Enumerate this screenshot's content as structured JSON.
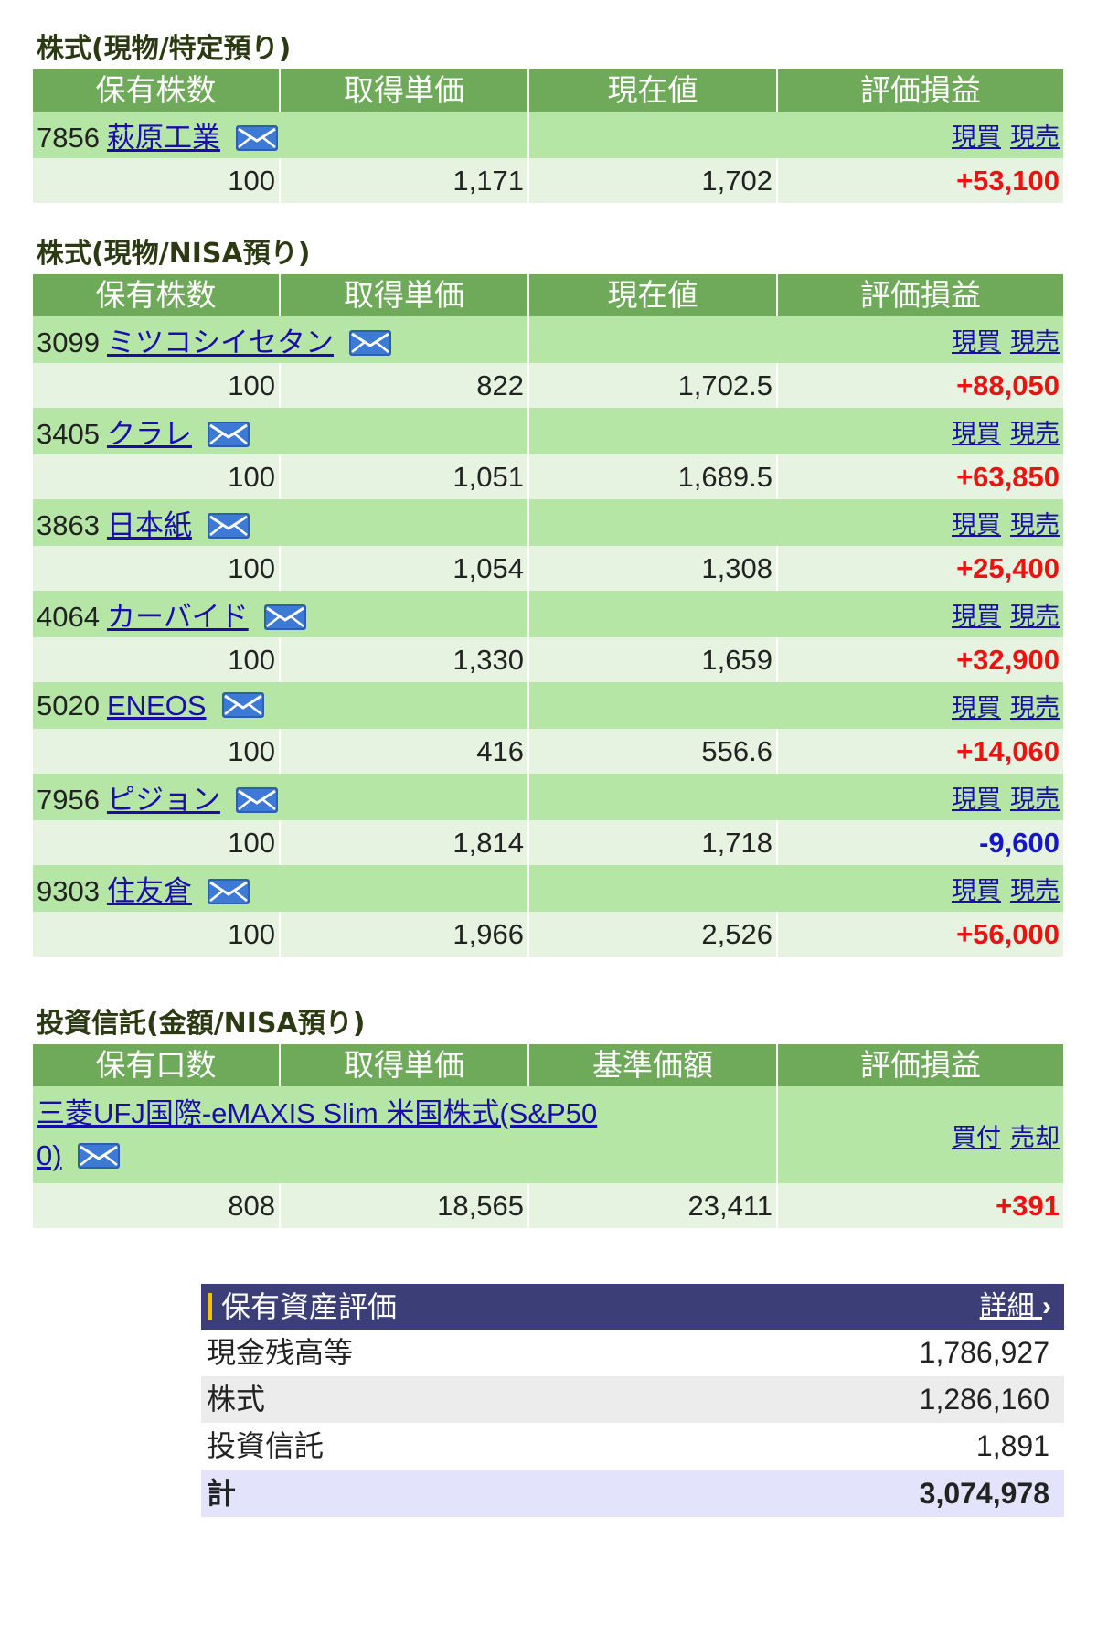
{
  "headers_stock": [
    "保有株数",
    "取得単価",
    "現在値",
    "評価損益"
  ],
  "headers_fund": [
    "保有口数",
    "取得単価",
    "基準価額",
    "評価損益"
  ],
  "actions_stock": {
    "buy": "現買",
    "sell": "現売"
  },
  "actions_fund": {
    "buy": "買付",
    "sell": "売却"
  },
  "section1": {
    "title": "株式(現物/特定預り)",
    "rows": [
      {
        "code": "7856",
        "name": "萩原工業",
        "qty": "100",
        "cost": "1,171",
        "price": "1,702",
        "pl": "+53,100"
      }
    ]
  },
  "section2": {
    "title": "株式(現物/NISA預り)",
    "rows": [
      {
        "code": "3099",
        "name": "ミツコシイセタン",
        "qty": "100",
        "cost": "822",
        "price": "1,702.5",
        "pl": "+88,050"
      },
      {
        "code": "3405",
        "name": "クラレ",
        "qty": "100",
        "cost": "1,051",
        "price": "1,689.5",
        "pl": "+63,850"
      },
      {
        "code": "3863",
        "name": "日本紙",
        "qty": "100",
        "cost": "1,054",
        "price": "1,308",
        "pl": "+25,400"
      },
      {
        "code": "4064",
        "name": "カーバイド",
        "qty": "100",
        "cost": "1,330",
        "price": "1,659",
        "pl": "+32,900"
      },
      {
        "code": "5020",
        "name": "ENEOS",
        "qty": "100",
        "cost": "416",
        "price": "556.6",
        "pl": "+14,060"
      },
      {
        "code": "7956",
        "name": "ピジョン",
        "qty": "100",
        "cost": "1,814",
        "price": "1,718",
        "pl": "-9,600"
      },
      {
        "code": "9303",
        "name": "住友倉",
        "qty": "100",
        "cost": "1,966",
        "price": "2,526",
        "pl": "+56,000"
      }
    ]
  },
  "section3": {
    "title": "投資信託(金額/NISA預り)",
    "fund": {
      "name_line1": "三菱UFJ国際-eMAXIS Slim 米国株式(S&P50",
      "name_line2": "0)",
      "qty": "808",
      "cost": "18,565",
      "price": "23,411",
      "pl": "+391"
    }
  },
  "summary": {
    "title": "保有資産評価",
    "detail_label": "詳細",
    "detail_arrow": "›",
    "rows": [
      {
        "label": "現金残高等",
        "value": "1,786,927"
      },
      {
        "label": "株式",
        "value": "1,286,160"
      },
      {
        "label": "投資信託",
        "value": "1,891"
      }
    ],
    "total": {
      "label": "計",
      "value": "3,074,978"
    }
  },
  "colors": {
    "header_green": "#6faa5a",
    "name_row": "#b6e6a6",
    "value_row": "#e6f3e1",
    "profit": "#ee1111",
    "loss": "#1515cc",
    "summary_header": "#3c3f77"
  }
}
